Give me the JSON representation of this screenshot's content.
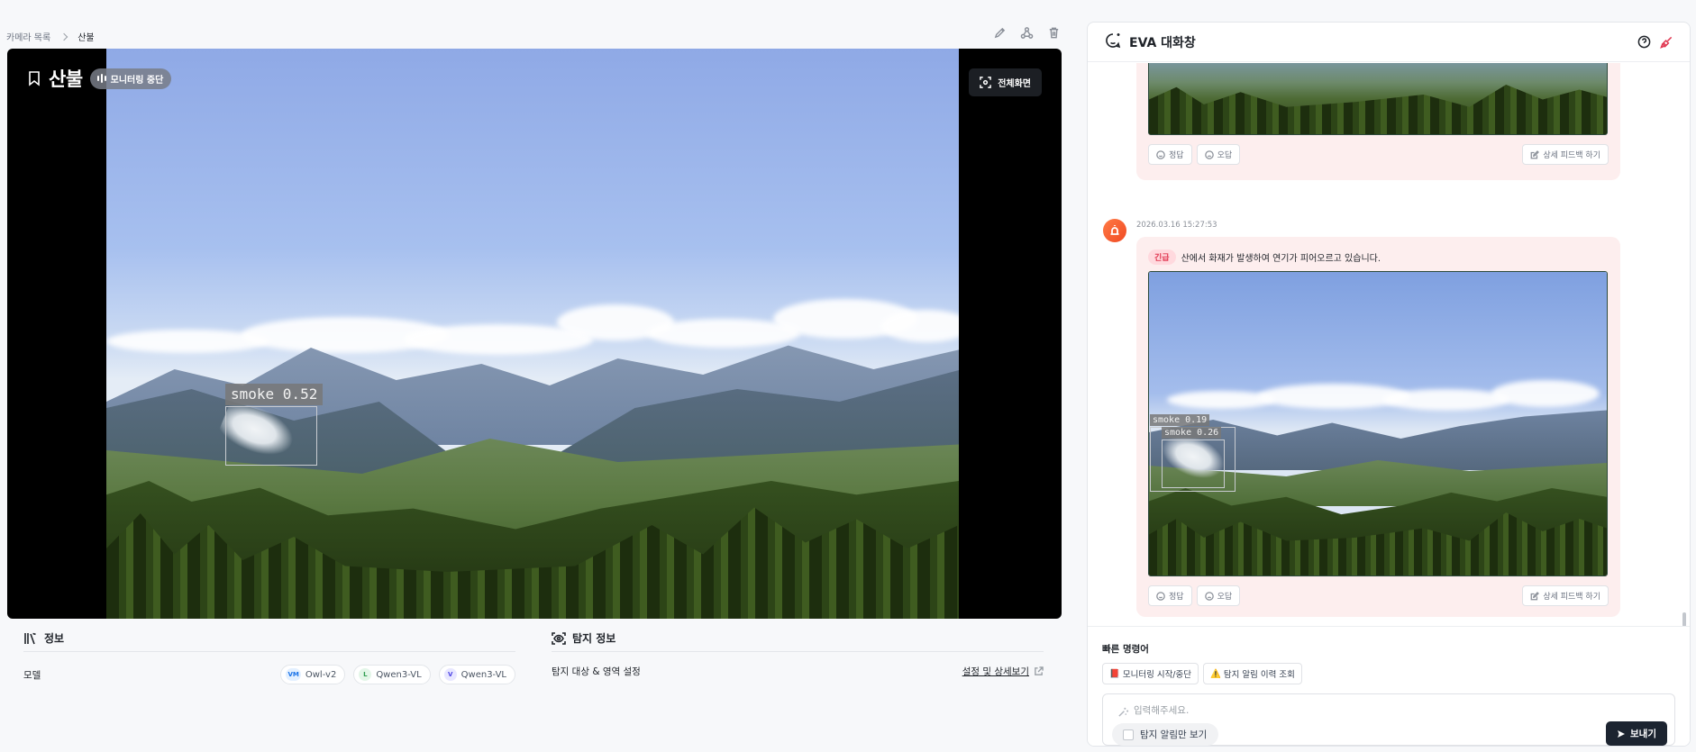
{
  "breadcrumb": {
    "parent": "카메라 목록",
    "current": "산불"
  },
  "camera": {
    "title": "산불",
    "status": "모니터링 중단",
    "fullscreen_label": "전체화면",
    "detection_label": "smoke 0.52"
  },
  "info": {
    "title": "정보",
    "model_label": "모델",
    "models": [
      {
        "badge": "VM",
        "name": "Owl-v2",
        "color": "#1a73e8",
        "bg": "#e3f0ff"
      },
      {
        "badge": "L",
        "name": "Qwen3-VL",
        "color": "#2e9d4f",
        "bg": "#e3f6e8"
      },
      {
        "badge": "V",
        "name": "Qwen3-VL",
        "color": "#4f46e5",
        "bg": "#e8e7ff"
      }
    ]
  },
  "detect_info": {
    "title": "탐지 정보",
    "target_label": "탐지 대상 & 영역 설정",
    "link_label": "설정 및 상세보기"
  },
  "chat": {
    "title": "EVA 대화창",
    "feedback": {
      "correct": "정답",
      "wrong": "오답",
      "detail": "상세 피드백 하기"
    },
    "message": {
      "timestamp": "2026.03.16 15:27:53",
      "badge": "긴급",
      "text": "산에서 화재가 발생하여 연기가 피어오르고 있습니다.",
      "det1": "smoke 0.19",
      "det2": "smoke 0.26"
    }
  },
  "quick": {
    "title": "빠른 명령어",
    "buttons": [
      {
        "icon": "📕",
        "label": "모니터링 시작/중단"
      },
      {
        "icon": "⚠️",
        "label": "탐지 알림 이력 조회"
      }
    ]
  },
  "input": {
    "placeholder": "입력해주세요.",
    "toggle_label": "탐지 알림만 보기",
    "send_label": "보내기"
  }
}
